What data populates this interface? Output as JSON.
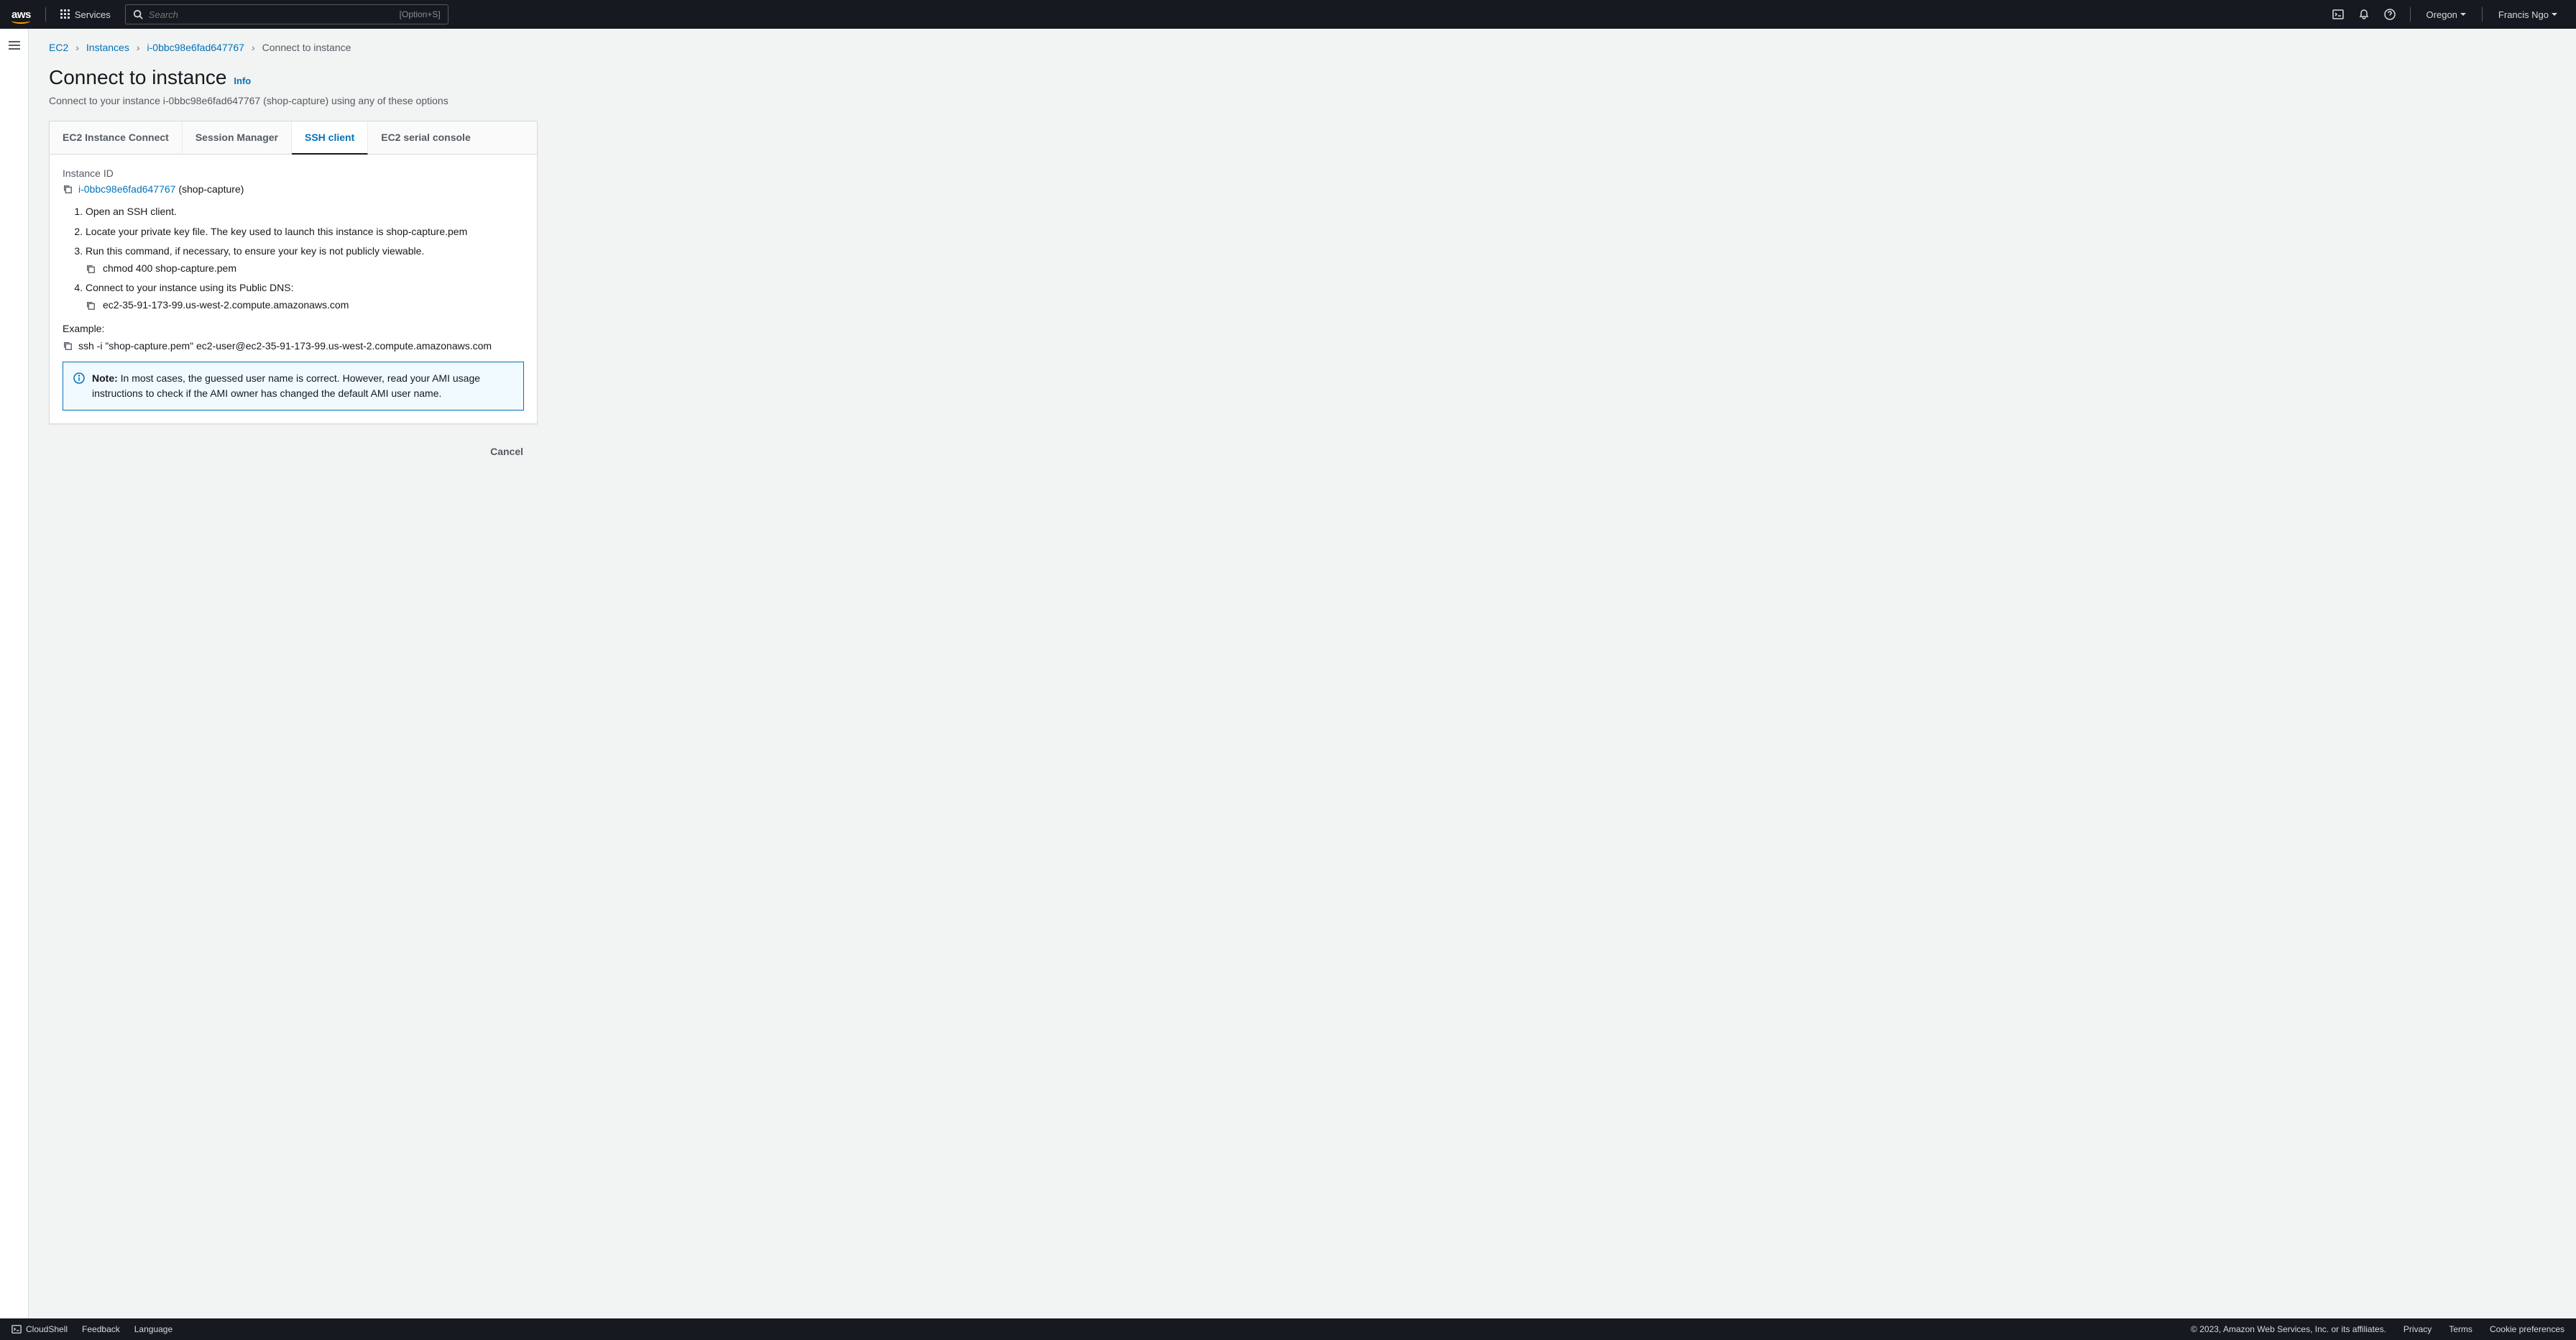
{
  "topbar": {
    "services_label": "Services",
    "search_placeholder": "Search",
    "search_shortcut": "[Option+S]",
    "region": "Oregon",
    "user": "Francis Ngo"
  },
  "breadcrumb": {
    "root": "EC2",
    "instances": "Instances",
    "instance_id": "i-0bbc98e6fad647767",
    "current": "Connect to instance"
  },
  "page": {
    "title": "Connect to instance",
    "info_link": "Info",
    "subtitle": "Connect to your instance i-0bbc98e6fad647767 (shop-capture) using any of these options"
  },
  "tabs": {
    "ec2_connect": "EC2 Instance Connect",
    "session_manager": "Session Manager",
    "ssh_client": "SSH client",
    "serial_console": "EC2 serial console"
  },
  "panel": {
    "instance_id_label": "Instance ID",
    "instance_id": "i-0bbc98e6fad647767",
    "instance_name_suffix": " (shop-capture)",
    "steps": {
      "s1": "Open an SSH client.",
      "s2": "Locate your private key file. The key used to launch this instance is shop-capture.pem",
      "s3": "Run this command, if necessary, to ensure your key is not publicly viewable.",
      "s3_code": "chmod 400 shop-capture.pem",
      "s4": "Connect to your instance using its Public DNS:",
      "s4_code": "ec2-35-91-173-99.us-west-2.compute.amazonaws.com"
    },
    "example_label": "Example:",
    "example_code": "ssh -i \"shop-capture.pem\" ec2-user@ec2-35-91-173-99.us-west-2.compute.amazonaws.com",
    "note_prefix": "Note: ",
    "note_text": "In most cases, the guessed user name is correct. However, read your AMI usage instructions to check if the AMI owner has changed the default AMI user name."
  },
  "actions": {
    "cancel": "Cancel"
  },
  "footer": {
    "cloudshell": "CloudShell",
    "feedback": "Feedback",
    "language": "Language",
    "copyright": "© 2023, Amazon Web Services, Inc. or its affiliates.",
    "privacy": "Privacy",
    "terms": "Terms",
    "cookie": "Cookie preferences"
  }
}
